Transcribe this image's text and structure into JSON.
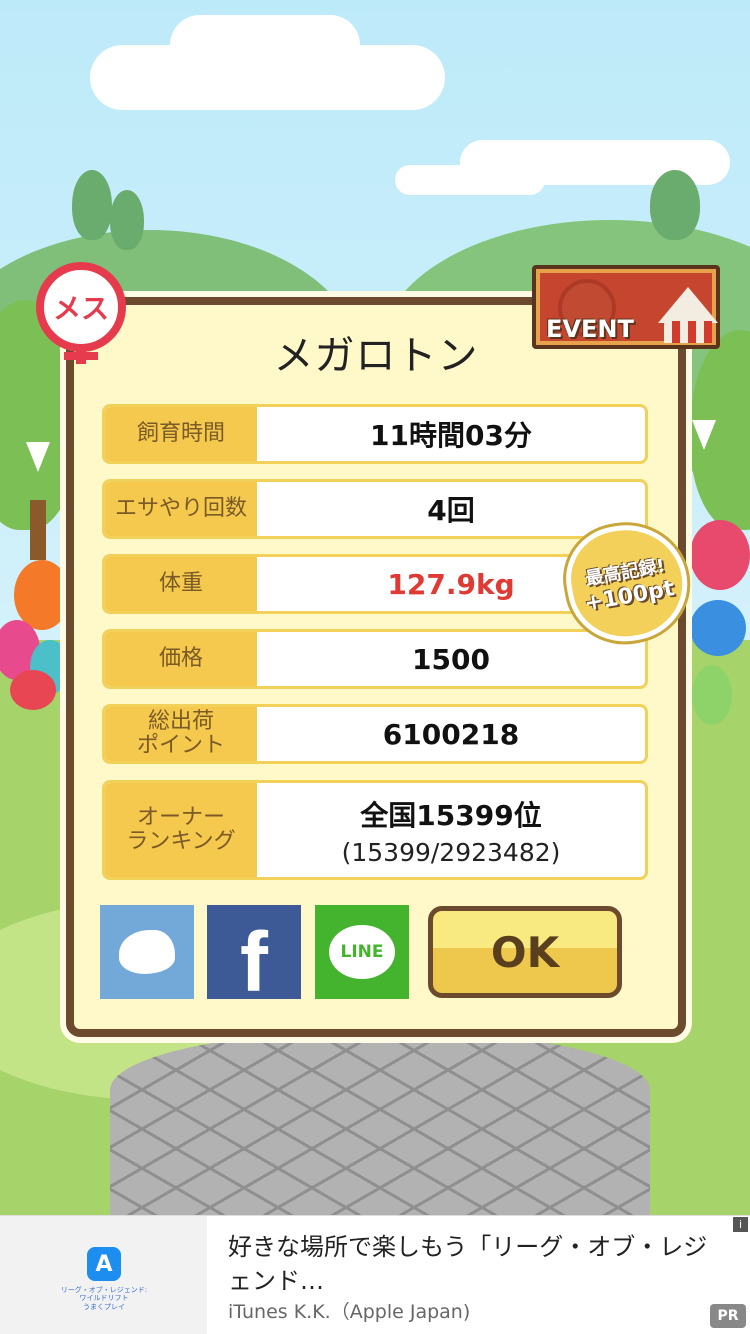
{
  "pet": {
    "name": "メガロトン",
    "gender_badge": "メス",
    "event_label": "EVENT"
  },
  "stats": [
    {
      "label": "飼育時間",
      "value": "11時間03分"
    },
    {
      "label": "エサやり回数",
      "value": "4回"
    },
    {
      "label": "体重",
      "value": "127.9kg"
    },
    {
      "label": "価格",
      "value": "1500"
    },
    {
      "label": "総出荷\nポイント",
      "value": "6100218"
    },
    {
      "label": "オーナー\nランキング",
      "value": "全国15399位",
      "sub": "(15399/2923482)"
    }
  ],
  "record": {
    "line1": "最高記録!",
    "line2": "+100pt"
  },
  "share": {
    "twitter_icon": "twitter-bird-icon",
    "facebook_glyph": "f",
    "line_label": "LINE"
  },
  "ok_label": "OK",
  "ad": {
    "icon_glyph": "A",
    "app_caption": "リーグ・オブ・レジェンド: ワイルドリフト\nうまくプレイ",
    "headline": "好きな場所で楽しもう「リーグ・オブ・レジェンド…",
    "advertiser": "iTunes K.K.（Apple Japan)",
    "info": "i",
    "pr": "PR"
  },
  "colors": {
    "dialog_bg": "#fff8c9",
    "dialog_border": "#6b4a2d",
    "label_bg": "#f5c94d",
    "weight_red": "#e03a34",
    "twitter": "#72a9d9",
    "facebook": "#3d5a96",
    "line": "#44b42e"
  }
}
